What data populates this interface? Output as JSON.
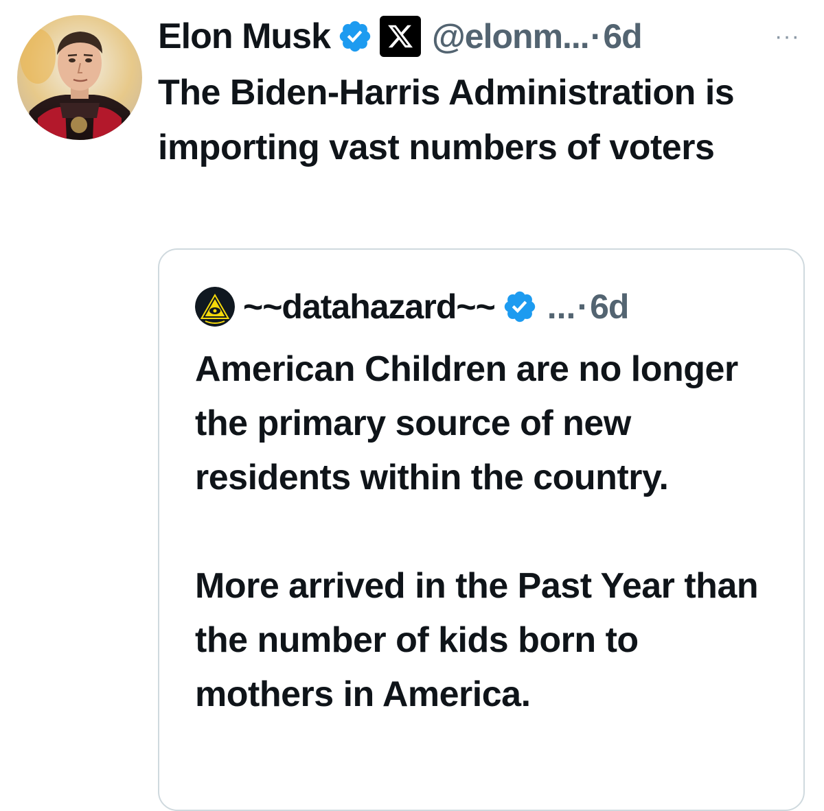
{
  "tweet": {
    "author": {
      "display_name": "Elon Musk",
      "handle": "@elonm...",
      "verified_icon": "verified-badge-icon",
      "affiliation_icon": "x-logo-icon"
    },
    "separator": "·",
    "time": "6d",
    "more_label": "···",
    "text": "The Biden-Harris Administration is importing vast numbers of voters",
    "colors": {
      "text": "#0f1419",
      "secondary": "#536471",
      "verified": "#1d9bf0",
      "border": "#cfd9de"
    }
  },
  "quote": {
    "author": {
      "display_name": "~~datahazard~~",
      "handle": "...",
      "avatar_icon": "hazard-triangle-icon",
      "verified_icon": "verified-badge-icon"
    },
    "separator": "·",
    "time": "6d",
    "paragraphs": [
      "American Children are no longer the primary source of new residents within the country.",
      "More arrived in the Past Year than the number of kids born to mothers in America."
    ]
  }
}
